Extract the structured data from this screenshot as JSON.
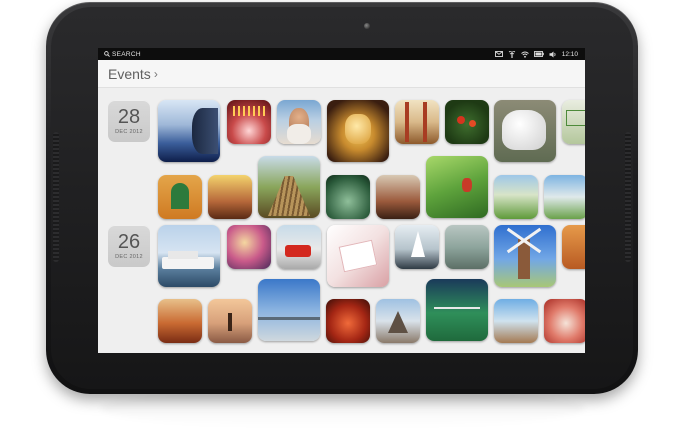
{
  "status_bar": {
    "search_label": "SEARCH",
    "time": "12:10",
    "icons": [
      "mail-icon",
      "wifi-icon",
      "battery-icon",
      "volume-icon"
    ]
  },
  "header": {
    "title": "Events",
    "chevron": "›"
  },
  "events": [
    {
      "day": "28",
      "month": "DEC 2012"
    },
    {
      "day": "26",
      "month": "DEC 2012"
    }
  ],
  "colors": {
    "status_bar": "#0d0d0d",
    "header_bg": "#f6f6f6",
    "screen_bg": "#efefef",
    "date_badge": "#d3d3d3"
  }
}
